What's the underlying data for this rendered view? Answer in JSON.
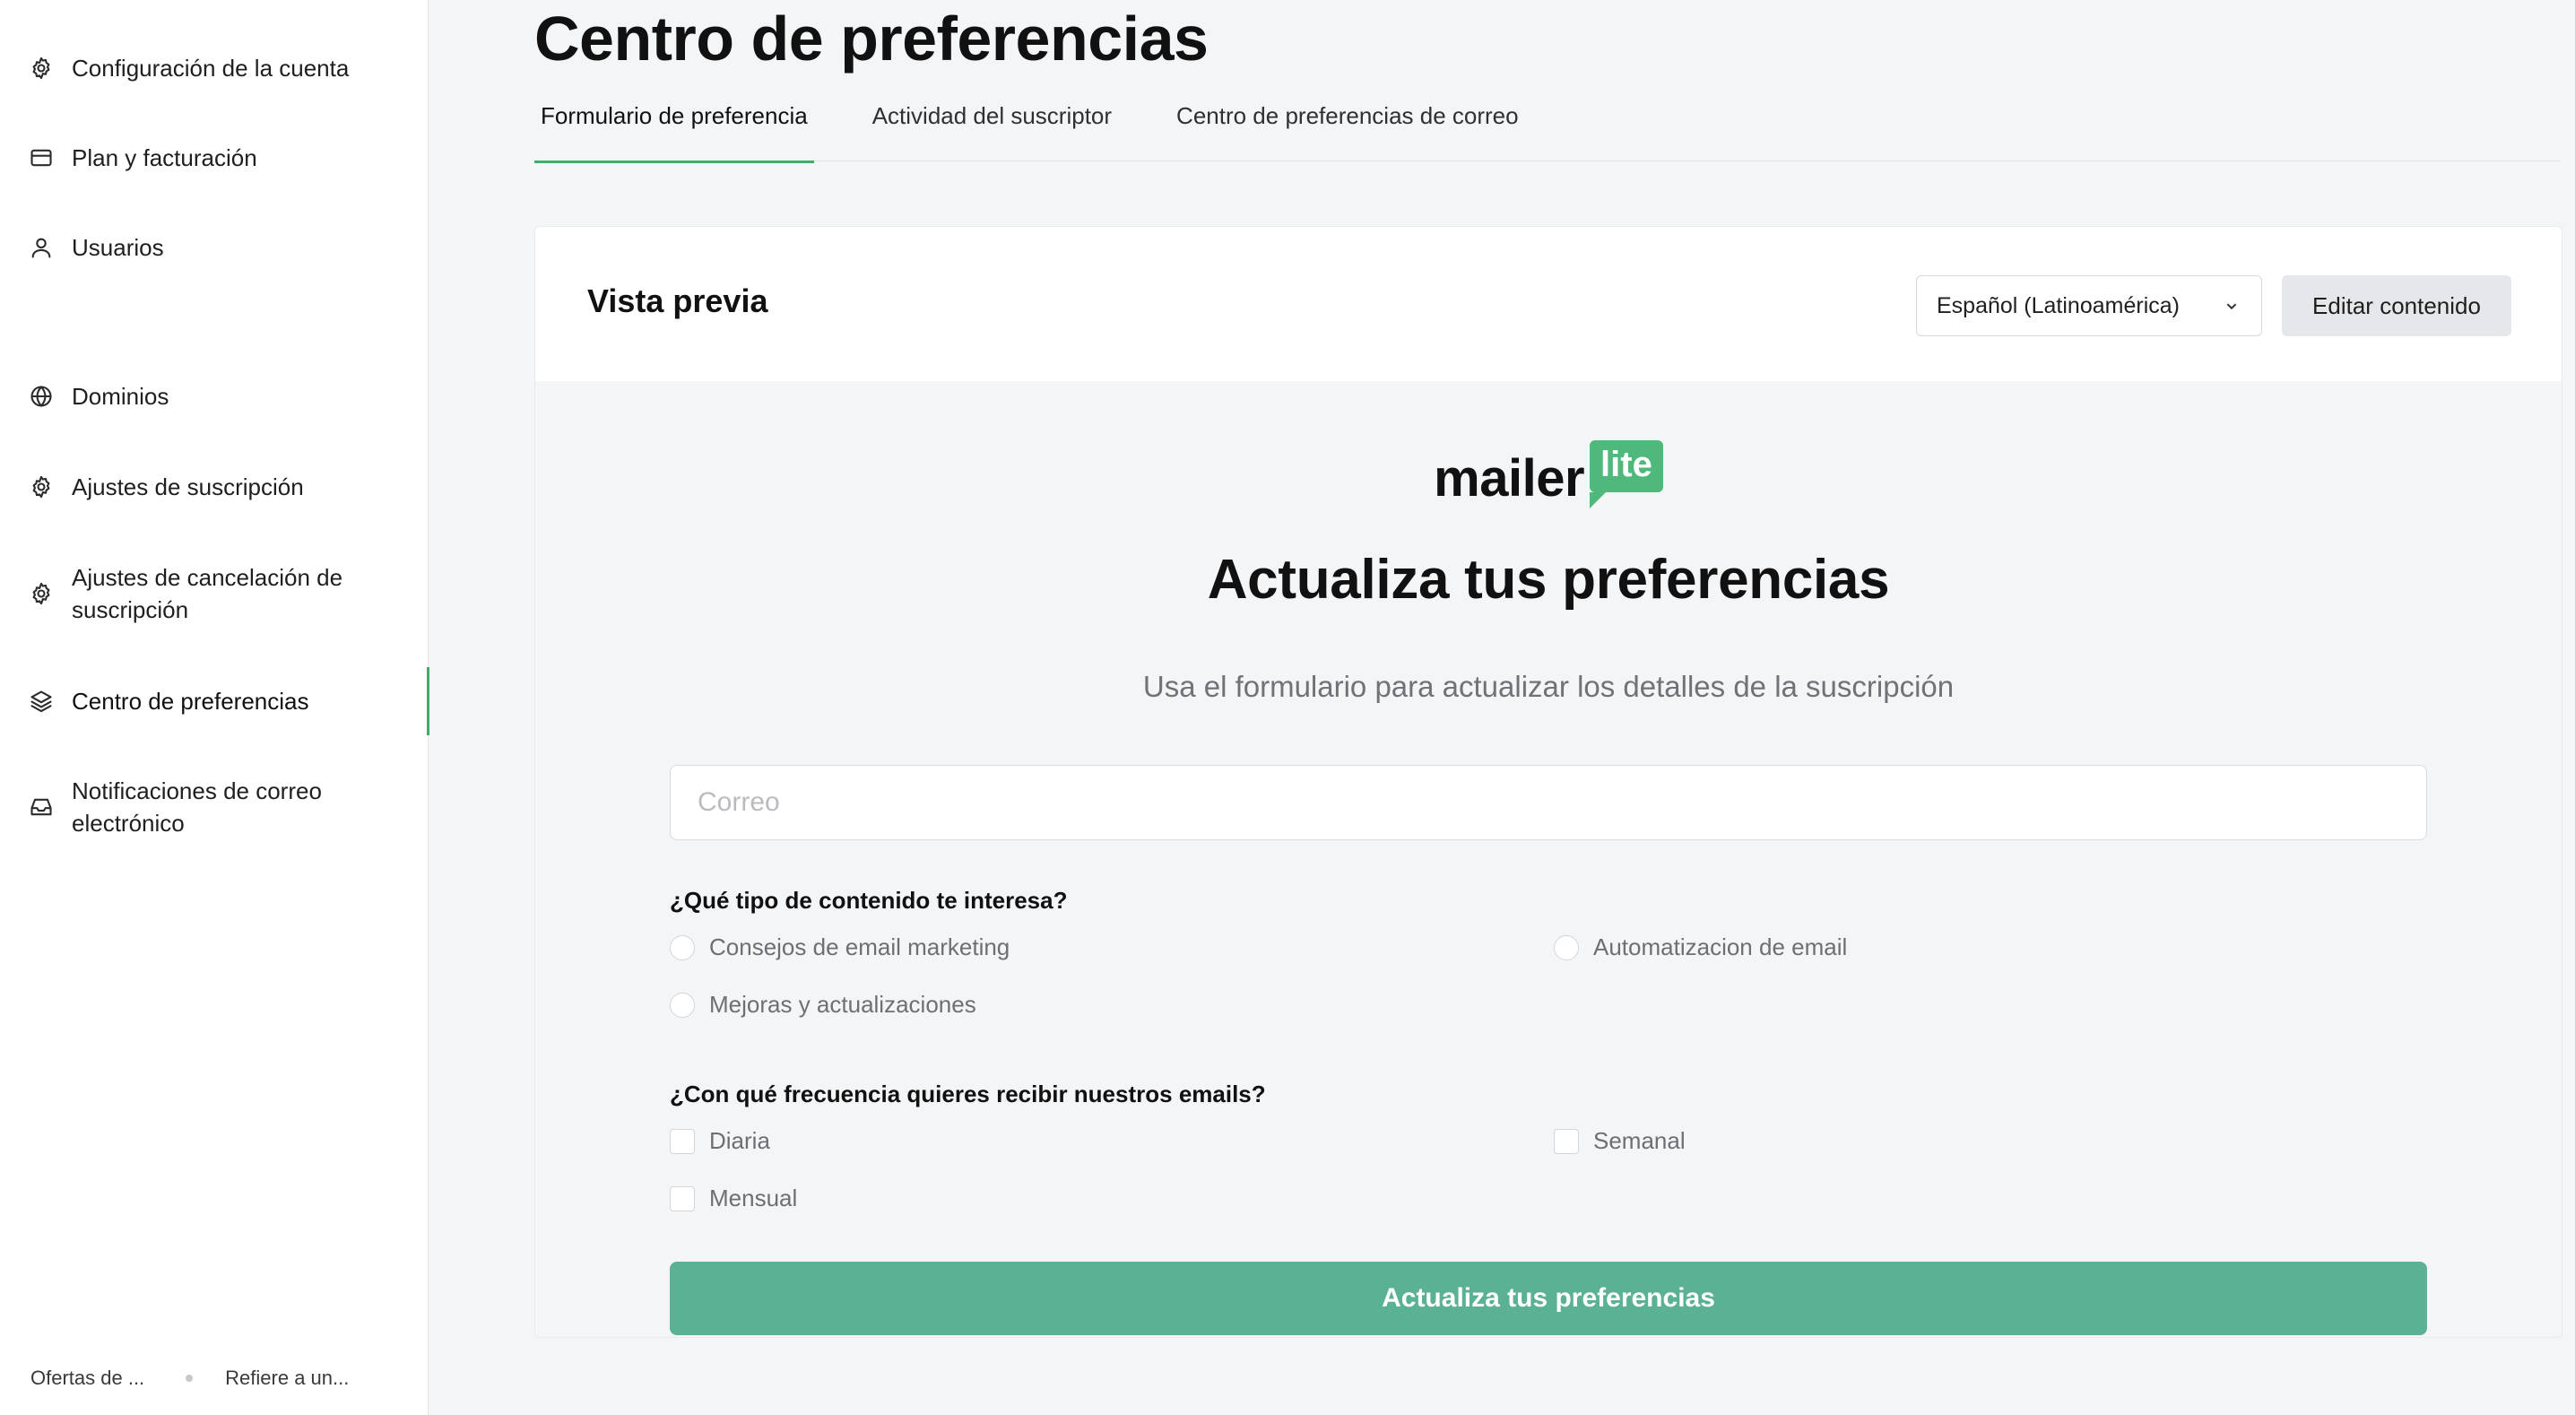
{
  "sidebar": {
    "items": [
      {
        "label": "Configuración de la cuenta",
        "icon": "gear-icon"
      },
      {
        "label": "Plan y facturación",
        "icon": "credit-card-icon"
      },
      {
        "label": "Usuarios",
        "icon": "user-icon"
      },
      {
        "label": "Dominios",
        "icon": "globe-icon"
      },
      {
        "label": "Ajustes de suscripción",
        "icon": "gear-icon"
      },
      {
        "label": "Ajustes de cancelación de suscripción",
        "icon": "gear-icon"
      },
      {
        "label": "Centro de preferencias",
        "icon": "layers-icon",
        "active": true
      },
      {
        "label": "Notificaciones de correo electrónico",
        "icon": "inbox-icon"
      }
    ],
    "footer": {
      "link1": "Ofertas de ...",
      "link2": "Refiere a un..."
    }
  },
  "page": {
    "title": "Centro de preferencias",
    "tabs": [
      {
        "label": "Formulario de preferencia",
        "active": true
      },
      {
        "label": "Actividad del suscriptor"
      },
      {
        "label": "Centro de preferencias de correo"
      }
    ]
  },
  "card": {
    "title": "Vista previa",
    "language": "Español (Latinoamérica)",
    "edit_label": "Editar contenido"
  },
  "preview": {
    "logo_word": "mailer",
    "logo_badge": "lite",
    "heading": "Actualiza tus preferencias",
    "subheading": "Usa el formulario para actualizar los detalles de la suscripción",
    "email_placeholder": "Correo",
    "email_value": "",
    "question1": "¿Qué tipo de contenido te interesa?",
    "q1_options": [
      "Consejos de email marketing",
      "Automatizacion de email",
      "Mejoras y actualizaciones"
    ],
    "question2": "¿Con qué frecuencia quieres recibir nuestros emails?",
    "q2_options": [
      "Diaria",
      "Semanal",
      "Mensual"
    ],
    "submit_label": "Actualiza tus preferencias"
  },
  "colors": {
    "accent": "#3fae6b",
    "submit": "#5bb194",
    "logo_badge": "#4fb97b"
  }
}
